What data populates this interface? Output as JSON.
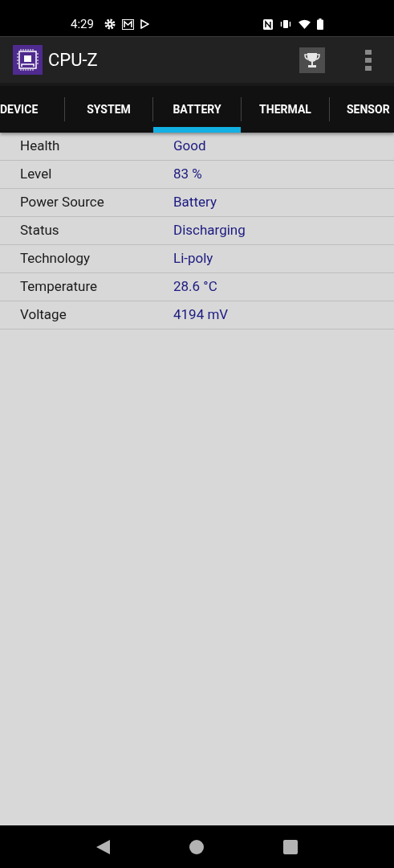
{
  "status_bar": {
    "time": "4:29"
  },
  "app_bar": {
    "title": "CPU-Z"
  },
  "tabs": [
    {
      "label": "DEVICE",
      "selected": false
    },
    {
      "label": "SYSTEM",
      "selected": false
    },
    {
      "label": "BATTERY",
      "selected": true
    },
    {
      "label": "THERMAL",
      "selected": false
    },
    {
      "label": "SENSOR",
      "selected": false
    }
  ],
  "rows": [
    {
      "label": "Health",
      "value": "Good"
    },
    {
      "label": "Level",
      "value": "83 %"
    },
    {
      "label": "Power Source",
      "value": "Battery"
    },
    {
      "label": "Status",
      "value": "Discharging"
    },
    {
      "label": "Technology",
      "value": "Li-poly"
    },
    {
      "label": "Temperature",
      "value": "28.6 °C"
    },
    {
      "label": "Voltage",
      "value": "4194 mV"
    }
  ]
}
